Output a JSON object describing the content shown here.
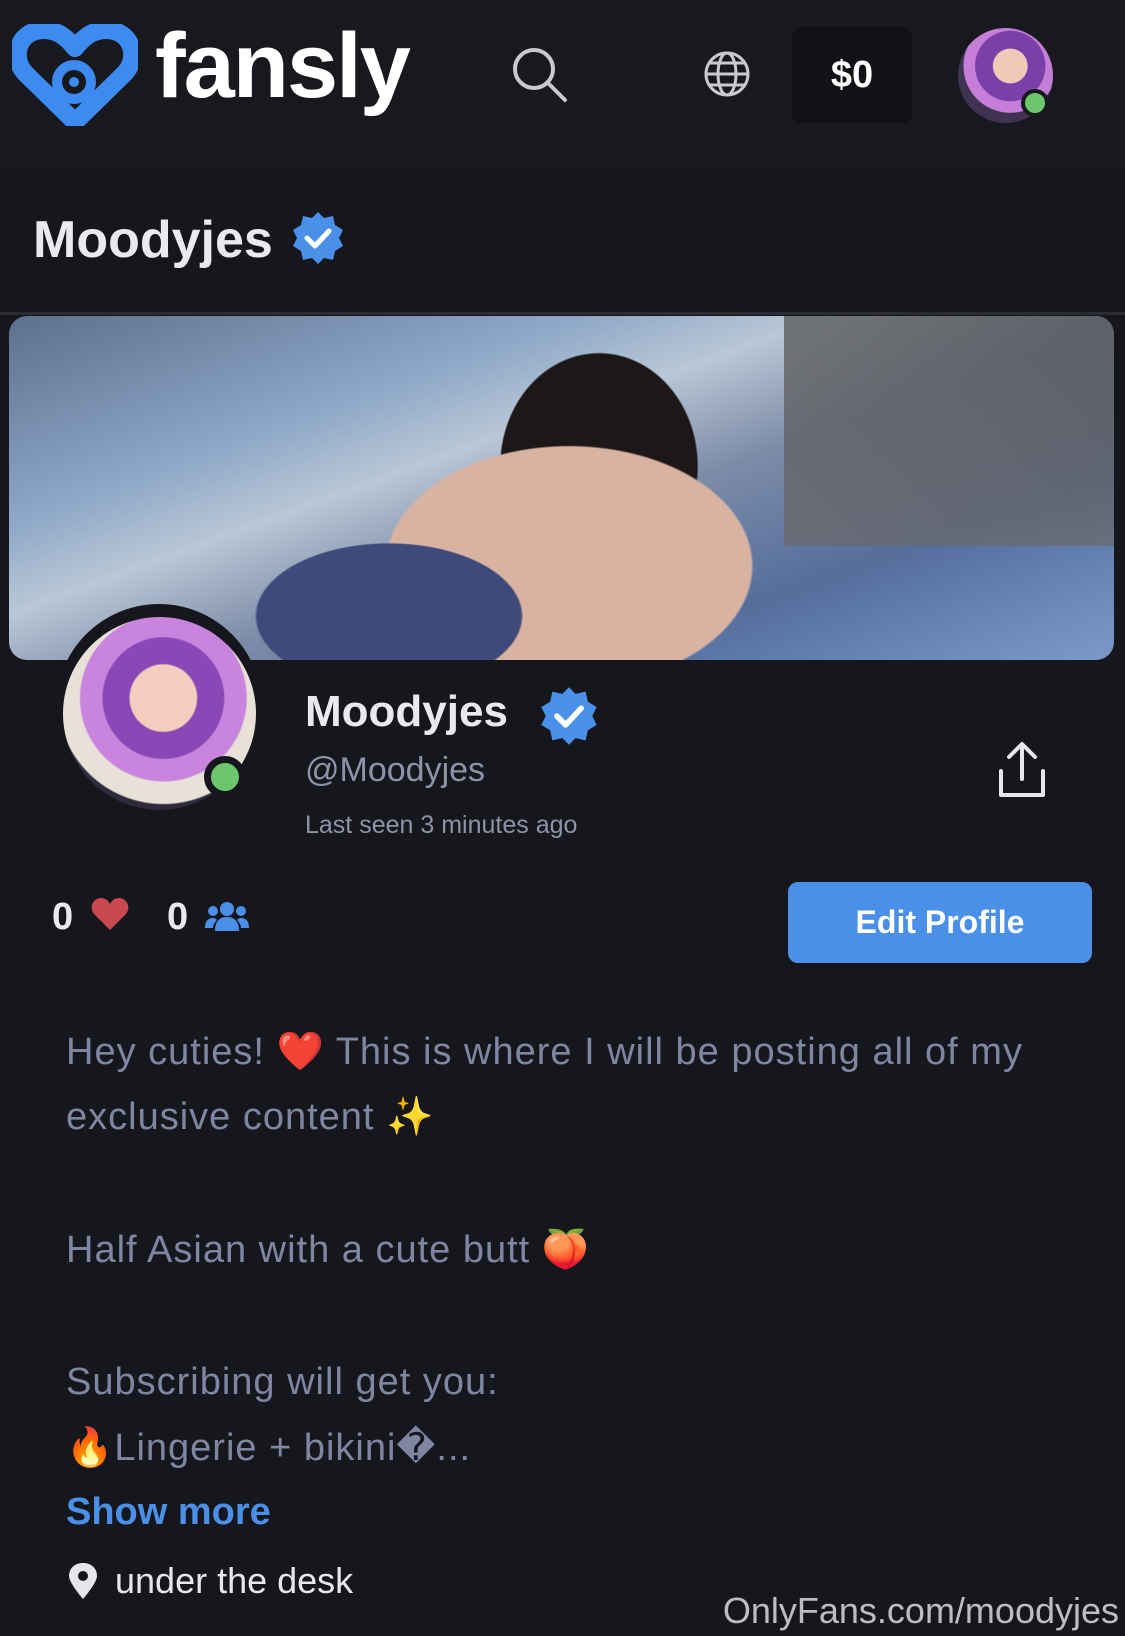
{
  "header": {
    "logo_text": "fansly",
    "balance": "$0",
    "icons": [
      "fansly-heart-logo-icon",
      "search-icon",
      "globe-icon",
      "avatar"
    ]
  },
  "page": {
    "title": "Moodyjes"
  },
  "profile": {
    "display_name": "Moodyjes",
    "handle": "@Moodyjes",
    "last_seen": "Last seen 3 minutes ago",
    "likes": "0",
    "followers": "0",
    "edit_button": "Edit Profile",
    "online_status_color": "#6cc76c",
    "verified_color": "#4a90e8"
  },
  "bio": {
    "line1": "Hey cuties! ❤️ This is where I will be posting all of my",
    "line2": "exclusive content ✨",
    "line3": "Half Asian with a cute butt 🍑",
    "line4": "Subscribing will get you:",
    "line5": "🔥Lingerie + bikini�...",
    "show_more": "Show more",
    "location": "under the desk"
  },
  "watermark": "OnlyFans.com/moodyjes",
  "colors": {
    "background": "#16171d",
    "accent": "#4a90e8",
    "heart": "#c9484f",
    "bio_text": "#7f86a2"
  }
}
